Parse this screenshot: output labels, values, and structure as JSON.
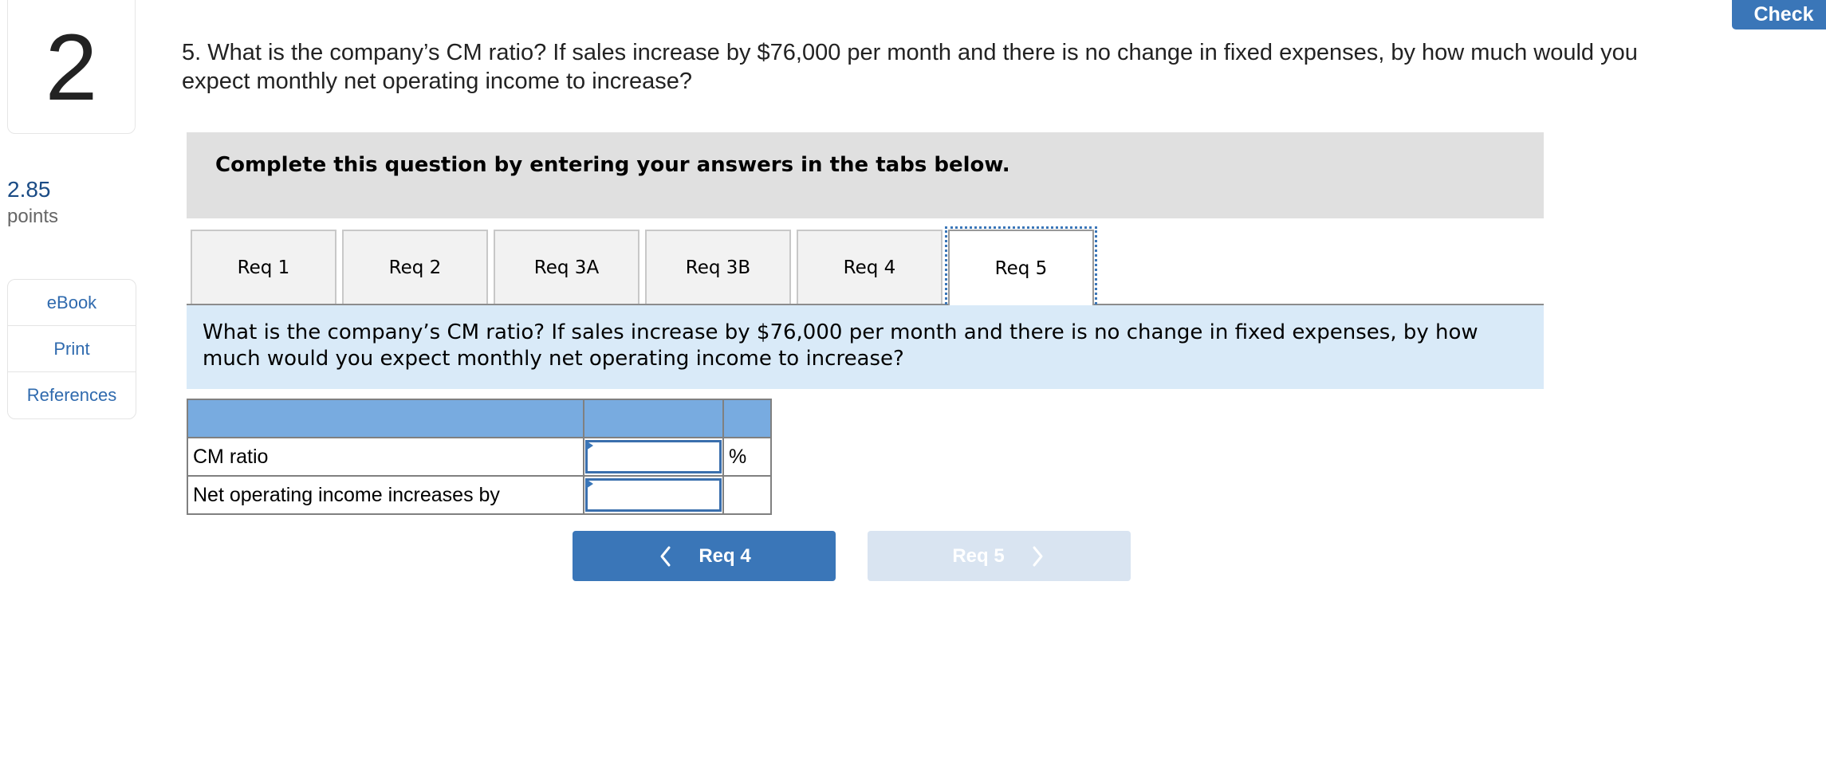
{
  "question_number": "2",
  "points": {
    "value": "2.85",
    "label": "points"
  },
  "sidebar": {
    "items": [
      {
        "label": "eBook"
      },
      {
        "label": "Print"
      },
      {
        "label": "References"
      }
    ]
  },
  "header": {
    "check_label": "Check"
  },
  "question": {
    "text": "5. What is the company’s CM ratio? If sales increase by $76,000 per month and there is no change in fixed expenses, by how much would you expect monthly net operating income to increase?"
  },
  "instructions": "Complete this question by entering your answers in the tabs below.",
  "tabs": [
    {
      "label": "Req 1",
      "active": false
    },
    {
      "label": "Req 2",
      "active": false
    },
    {
      "label": "Req 3A",
      "active": false
    },
    {
      "label": "Req 3B",
      "active": false
    },
    {
      "label": "Req 4",
      "active": false
    },
    {
      "label": "Req 5",
      "active": true
    }
  ],
  "prompt": "What is the company’s CM ratio? If sales increase by $76,000 per month and there is no change in fixed expenses, by how much would you expect monthly net operating income to increase?",
  "answer_table": {
    "header": [
      "",
      "",
      ""
    ],
    "rows": [
      {
        "label": "CM ratio",
        "value": "",
        "unit": "%"
      },
      {
        "label": "Net operating income increases by",
        "value": "",
        "unit": ""
      }
    ]
  },
  "navigation": {
    "prev_label": "Req 4",
    "next_label": "Req 5",
    "next_disabled": true
  },
  "colors": {
    "accent": "#3a76b8",
    "table_header": "#78abe0",
    "prompt_bg": "#d9eaf8",
    "instructions_bg": "#e0e0e0",
    "points_value": "#1a4b85"
  }
}
